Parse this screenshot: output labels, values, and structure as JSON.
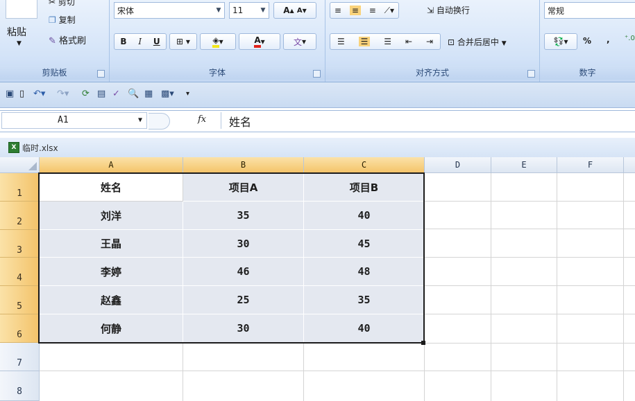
{
  "clipboard": {
    "paste": "粘贴",
    "cut": "剪切",
    "copy": "复制",
    "format_painter": "格式刷",
    "group_label": "剪贴板"
  },
  "font": {
    "name": "宋体",
    "size": "11",
    "bold": "B",
    "italic": "I",
    "underline": "U",
    "group_label": "字体"
  },
  "alignment": {
    "wrap_text": "自动换行",
    "merge_center": "合并后居中",
    "group_label": "对齐方式"
  },
  "number": {
    "format": "常规",
    "percent": "%",
    "comma": ",",
    "group_label": "数字"
  },
  "formula_bar": {
    "name_box": "A1",
    "fx": "fx",
    "value": "姓名"
  },
  "workbook": {
    "title": "临时.xlsx"
  },
  "columns": [
    "A",
    "B",
    "C",
    "D",
    "E",
    "F"
  ],
  "rows": [
    "1",
    "2",
    "3",
    "4",
    "5",
    "6",
    "7",
    "8"
  ],
  "table": {
    "headers": [
      "姓名",
      "项目A",
      "项目B"
    ],
    "data": [
      [
        "刘洋",
        "35",
        "40"
      ],
      [
        "王晶",
        "30",
        "45"
      ],
      [
        "李婷",
        "46",
        "48"
      ],
      [
        "赵鑫",
        "25",
        "35"
      ],
      [
        "何静",
        "30",
        "40"
      ]
    ]
  },
  "colors": {
    "selection_border": "#1b1b1b",
    "header_highlight": "#f4c46a",
    "cell_fill": "#e4e8f0"
  }
}
